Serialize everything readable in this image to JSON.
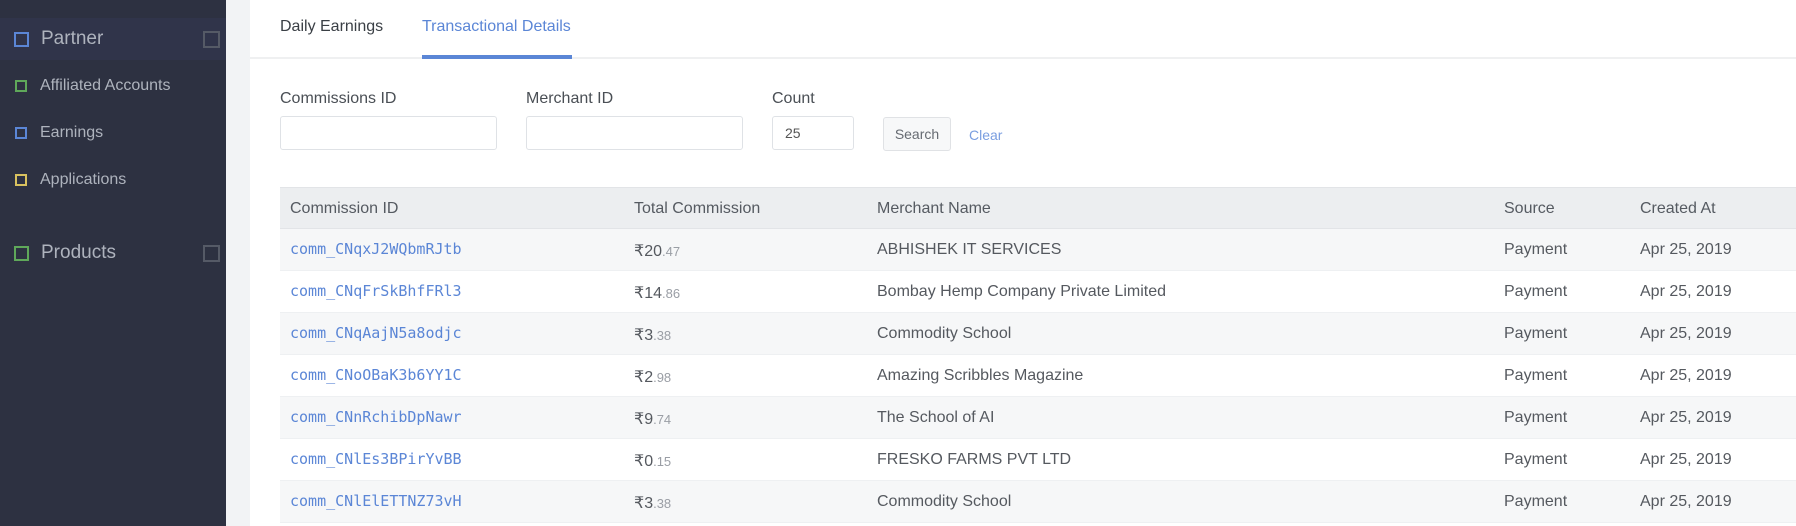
{
  "sidebar": {
    "sections": [
      {
        "title": "Partner",
        "icon": "square-outline-blue",
        "items": [
          {
            "label": "Affiliated Accounts",
            "icon": "square-outline-green"
          },
          {
            "label": "Earnings",
            "icon": "square-outline-blue"
          },
          {
            "label": "Applications",
            "icon": "square-outline-yellow"
          }
        ]
      },
      {
        "title": "Products",
        "icon": "square-outline-green",
        "items": []
      }
    ]
  },
  "tabs": [
    {
      "label": "Daily Earnings",
      "active": false
    },
    {
      "label": "Transactional Details",
      "active": true
    }
  ],
  "filters": {
    "commissions_id": {
      "label": "Commissions ID",
      "value": "",
      "placeholder": ""
    },
    "merchant_id": {
      "label": "Merchant ID",
      "value": "",
      "placeholder": ""
    },
    "count": {
      "label": "Count",
      "value": "25"
    },
    "search_label": "Search",
    "clear_label": "Clear"
  },
  "table": {
    "columns": [
      "Commission ID",
      "Total Commission",
      "Merchant Name",
      "Source",
      "Created At"
    ],
    "rows": [
      {
        "id": "comm_CNqxJ2WQbmRJtb",
        "currency": "₹",
        "amount_int": "20",
        "amount_frac": ".47",
        "merchant": "ABHISHEK IT SERVICES",
        "source": "Payment",
        "created": "Apr 25, 2019"
      },
      {
        "id": "comm_CNqFrSkBhfFRl3",
        "currency": "₹",
        "amount_int": "14",
        "amount_frac": ".86",
        "merchant": "Bombay Hemp Company Private Limited",
        "source": "Payment",
        "created": "Apr 25, 2019"
      },
      {
        "id": "comm_CNqAajN5a8odjc",
        "currency": "₹",
        "amount_int": "3",
        "amount_frac": ".38",
        "merchant": "Commodity School",
        "source": "Payment",
        "created": "Apr 25, 2019"
      },
      {
        "id": "comm_CNoOBaK3b6YY1C",
        "currency": "₹",
        "amount_int": "2",
        "amount_frac": ".98",
        "merchant": "Amazing Scribbles Magazine",
        "source": "Payment",
        "created": "Apr 25, 2019"
      },
      {
        "id": "comm_CNnRchibDpNawr",
        "currency": "₹",
        "amount_int": "9",
        "amount_frac": ".74",
        "merchant": "The School of AI",
        "source": "Payment",
        "created": "Apr 25, 2019"
      },
      {
        "id": "comm_CNlEs3BPirYvBB",
        "currency": "₹",
        "amount_int": "0",
        "amount_frac": ".15",
        "merchant": "FRESKO FARMS PVT LTD",
        "source": "Payment",
        "created": "Apr 25, 2019"
      },
      {
        "id": "comm_CNlElETTNZ73vH",
        "currency": "₹",
        "amount_int": "3",
        "amount_frac": ".38",
        "merchant": "Commodity School",
        "source": "Payment",
        "created": "Apr 25, 2019"
      }
    ]
  },
  "colors": {
    "accent": "#5b86d6",
    "sidebar_bg": "#2d3141",
    "icon_blue": "#5b86d6",
    "icon_green": "#5fa85a",
    "icon_yellow": "#d8c15f"
  }
}
